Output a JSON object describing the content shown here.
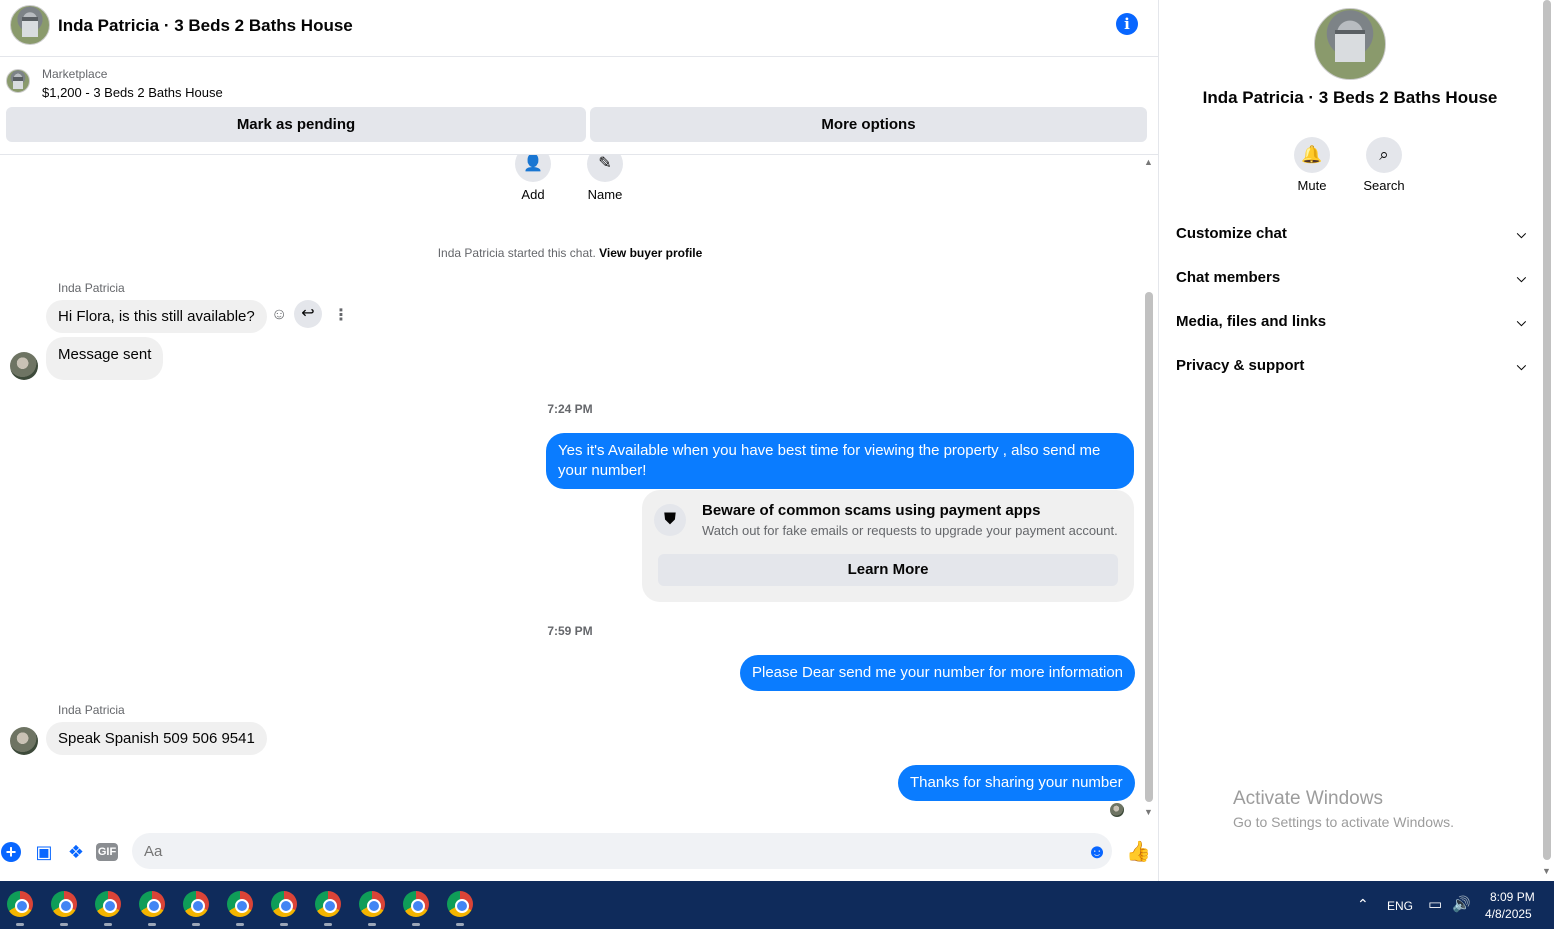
{
  "header": {
    "title": "Inda Patricia · 3 Beds 2 Baths House",
    "info_icon": "i"
  },
  "marketplace": {
    "label": "Marketplace",
    "item": "$1,200 - 3 Beds 2 Baths House"
  },
  "actions": {
    "pending": "Mark as pending",
    "more": "More options"
  },
  "chat_top": {
    "add_label": "Add",
    "name_label": "Name"
  },
  "system_note": {
    "text": "Inda Patricia started this chat.",
    "link": "View buyer profile"
  },
  "messages": {
    "sender1": "Inda Patricia",
    "m1": "Hi Flora, is this still available?",
    "m2": "Message sent",
    "time1": "7:24 PM",
    "m3": "Yes it's Available when you have best time for viewing the property , also send me your number!",
    "warn_title": "Beware of common scams using payment apps",
    "warn_sub": "Watch out for fake emails or requests to upgrade your payment account.",
    "learn_more": "Learn More",
    "time2": "7:59 PM",
    "m4": "Please Dear send me your number for more information",
    "sender2": "Inda Patricia",
    "m5": "Speak Spanish 509 506 9541",
    "m6": "Thanks for sharing your number"
  },
  "composer": {
    "placeholder": "Aa",
    "gif": "GIF"
  },
  "sidebar": {
    "title": "Inda Patricia · 3 Beds 2 Baths House",
    "mute": "Mute",
    "search": "Search",
    "sections": [
      "Customize chat",
      "Chat members",
      "Media, files and links",
      "Privacy & support"
    ]
  },
  "watermark": {
    "line1": "Activate Windows",
    "line2": "Go to Settings to activate Windows."
  },
  "taskbar": {
    "lang": "ENG",
    "time": "8:09 PM",
    "date": "4/8/2025"
  }
}
